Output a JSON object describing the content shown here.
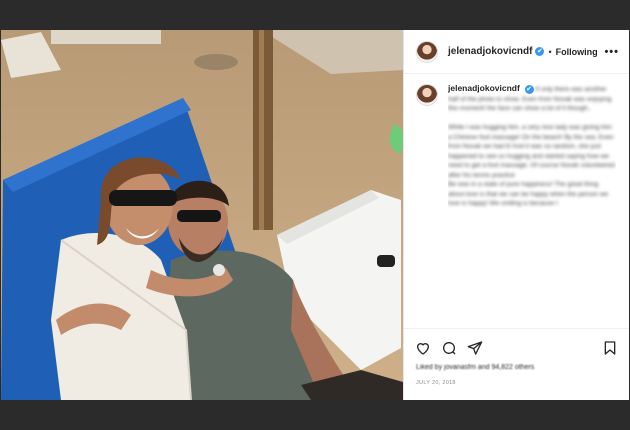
{
  "header": {
    "username": "jelenadjokovicndf",
    "verified_mark": "✔",
    "separator": "•",
    "follow_label": "Following",
    "more_label": "•••"
  },
  "caption": {
    "username": "jelenadjokovicndf",
    "text": "If only there was another half of the photo to show. Even from Novak was enjoying this moment! the face can show a lot of it though..",
    "text2": "While I was hugging him, a very nice lady was giving him a Chinese foot massage! On the beach! By the sea. Even from Novak we had it! And it was so random, she just happened to see us hugging and started saying how we need to get a foot massage. Of course Novak volunteered after his tennis practice",
    "text3": "Be was in a state of pure happiness! The great thing about love is that we can be happy when the person we love is happy! We smiling is because I"
  },
  "likes_text": "Liked by jovanasfm and 94,822 others",
  "date": "JULY 20, 2018",
  "icons": {
    "like": "heart-icon",
    "comment": "comment-icon",
    "share": "paper-plane-icon",
    "save": "bookmark-icon"
  }
}
